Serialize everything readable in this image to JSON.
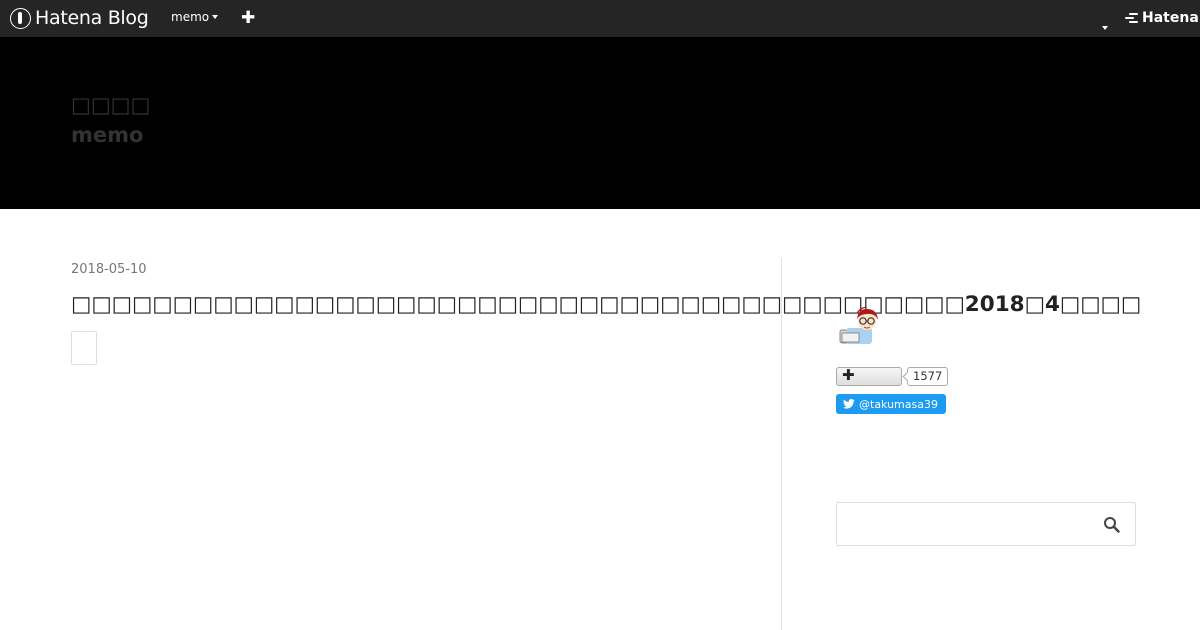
{
  "topbar": {
    "logo_text": "Hatena Blog",
    "blog_menu_label": "memo",
    "add_label": "✚",
    "brand_label": "Hatena"
  },
  "header": {
    "title_line1": "□□□□",
    "title_line2": "memo"
  },
  "entry": {
    "date": "2018-05-10",
    "title": "□□□□□□□□□□□□□□□□□□□□□□□□□□□□□□□□□□□□□□□□□□□□2018□4□□□□"
  },
  "sidebar": {
    "subscribe_count": "1577",
    "twitter_handle": "@takumasa39",
    "search_placeholder": ""
  },
  "colors": {
    "topbar_bg": "#252525",
    "header_bg": "#000000",
    "twitter_blue": "#1d9bf0"
  },
  "icons": {
    "logo": "hatena-pen-icon",
    "add": "plus-icon",
    "subscribe": "plus-icon",
    "twitter": "twitter-bird-icon",
    "search": "magnifier-icon"
  }
}
